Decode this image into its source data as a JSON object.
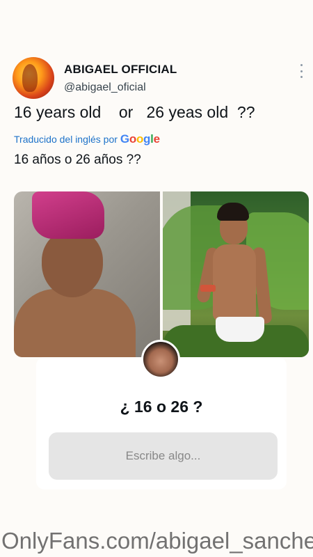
{
  "profile": {
    "display_name": "ABIGAEL OFFICIAL",
    "handle": "@abigael_oficial",
    "avatar_icon": "profile-avatar"
  },
  "tweet": {
    "text": "16 years old    or   26 yeas old  ??",
    "translate_label": "Traducido del inglés por",
    "translated_text": "16 años o 26 años ??",
    "more_icon": "more-vertical-icon"
  },
  "google_logo": [
    "G",
    "o",
    "o",
    "g",
    "l",
    "e"
  ],
  "media": {
    "photos": [
      "photo-left",
      "photo-right"
    ]
  },
  "card": {
    "question": "¿ 16 o 26 ?",
    "input_placeholder": "Escribe algo..."
  },
  "watermark": "OnlyFans.com/abigael_sanchez",
  "colors": {
    "background": "#fdfbf8",
    "translate_link": "#1d72c9",
    "input_bg": "#e5e5e5"
  }
}
